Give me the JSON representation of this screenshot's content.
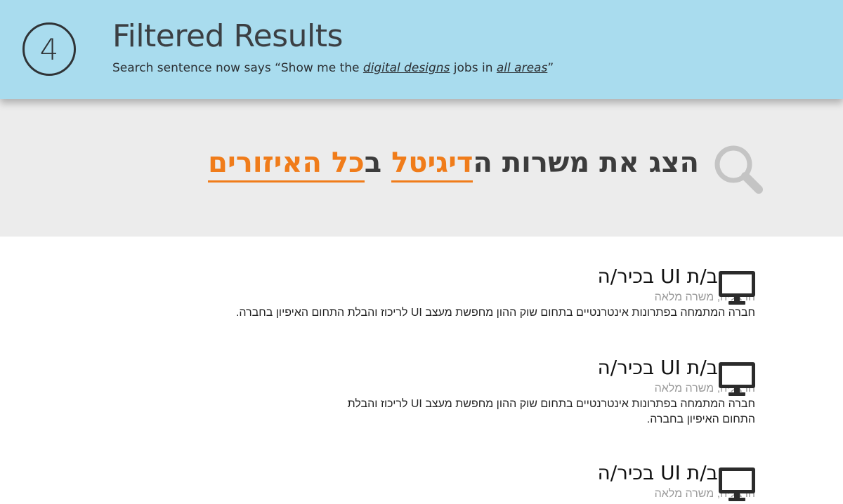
{
  "banner": {
    "step_number": "4",
    "title": "Filtered Results",
    "subtitle_prefix": "Search sentence now says “Show me the ",
    "subtitle_category": "digital designs",
    "subtitle_middle": " jobs in ",
    "subtitle_area": "all areas",
    "subtitle_suffix": "”"
  },
  "search_sentence": {
    "part1": "הצג את משרות ה",
    "category": "דיגיטל",
    "part2": " ב",
    "area": "כל האיזורים",
    "highlight_color": "#f07c1a",
    "icon": "search-icon"
  },
  "jobs": [
    {
      "title": "מעצב/ת UI בכיר/ה",
      "meta": "הרצליה, משרה מלאה",
      "description": "חברה המתמחה בפתרונות אינטרנטיים בתחום שוק ההון מחפשת מעצב UI לריכוז והבלת התחום האיפיון בחברה.",
      "icon": "monitor-icon"
    },
    {
      "title": "מעצב/ת UI בכיר/ה",
      "meta": "הרצליה, משרה מלאה",
      "description": "חברה המתמחה בפתרונות אינטרנטיים בתחום שוק ההון מחפשת מעצב UI לריכוז והבלת התחום האיפיון בחברה.",
      "icon": "monitor-icon"
    },
    {
      "title": "מעצב/ת UI בכיר/ה",
      "meta": "הרצליה, משרה מלאה",
      "description": "",
      "icon": "monitor-icon"
    }
  ],
  "colors": {
    "banner": "#a9dcee",
    "search_background": "#ececec",
    "accent": "#f07c1a"
  }
}
